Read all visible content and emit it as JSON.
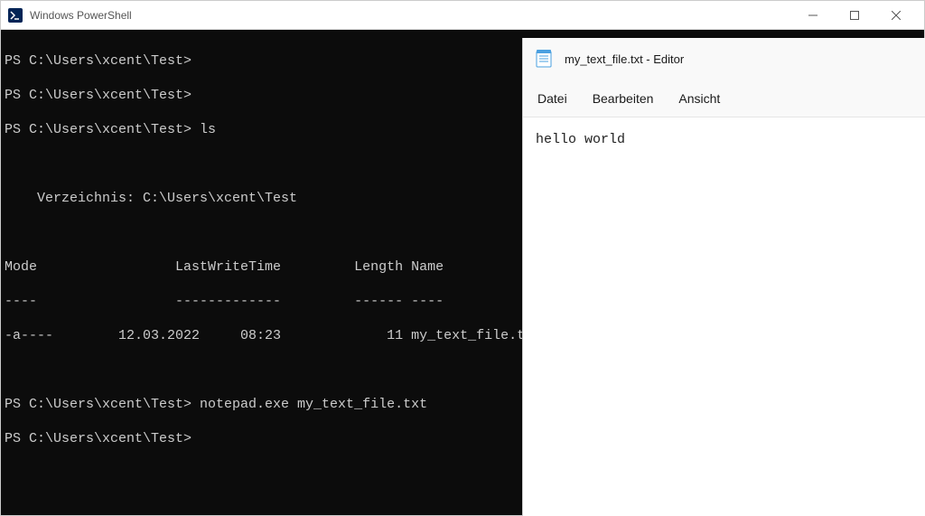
{
  "powershell": {
    "title": "Windows PowerShell",
    "lines": {
      "l0": "PS C:\\Users\\xcent\\Test>",
      "l1": "PS C:\\Users\\xcent\\Test>",
      "l2": "PS C:\\Users\\xcent\\Test> ls",
      "l3": "",
      "l4": "",
      "l5": "    Verzeichnis: C:\\Users\\xcent\\Test",
      "l6": "",
      "l7": "",
      "l8": "Mode                 LastWriteTime         Length Name",
      "l9": "----                 -------------         ------ ----",
      "l10": "-a----        12.03.2022     08:23             11 my_text_file.txt",
      "l11": "",
      "l12": "",
      "l13": "PS C:\\Users\\xcent\\Test> notepad.exe my_text_file.txt",
      "l14": "PS C:\\Users\\xcent\\Test>"
    }
  },
  "notepad": {
    "title": "my_text_file.txt - Editor",
    "menu": {
      "file": "Datei",
      "edit": "Bearbeiten",
      "view": "Ansicht"
    },
    "content": "hello world"
  }
}
